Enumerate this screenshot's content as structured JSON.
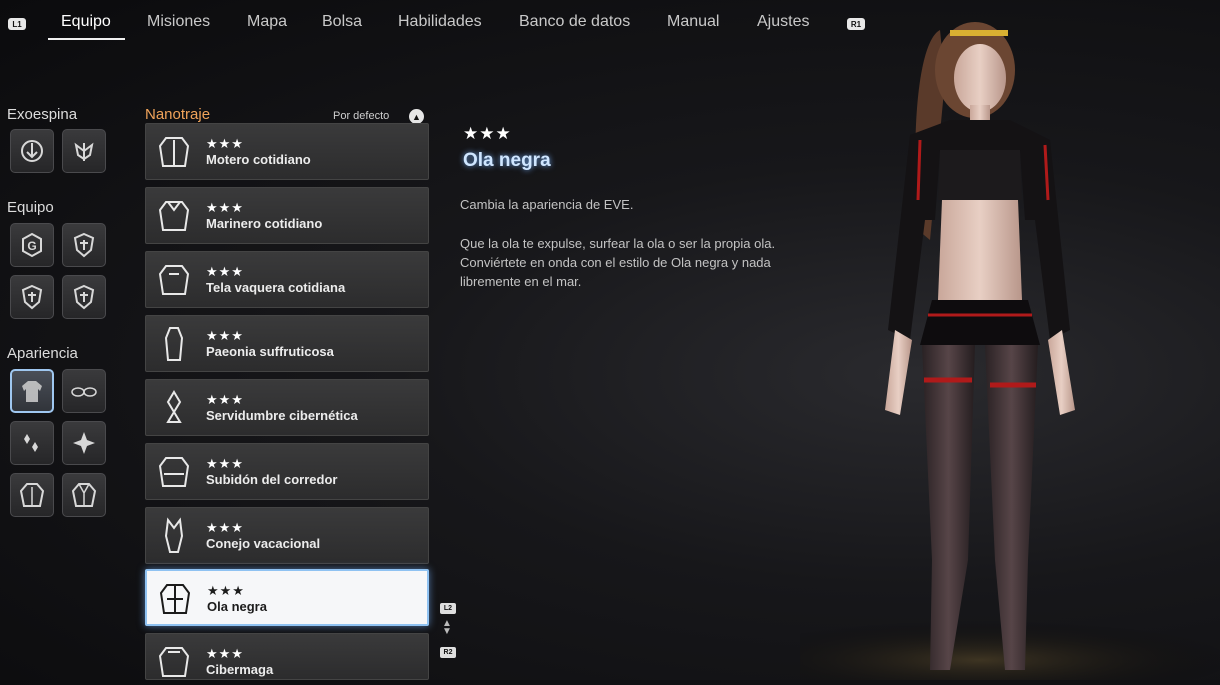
{
  "nav": {
    "left_hint": "L1",
    "right_hint": "R1",
    "tabs": [
      {
        "label": "Equipo"
      },
      {
        "label": "Misiones"
      },
      {
        "label": "Mapa"
      },
      {
        "label": "Bolsa"
      },
      {
        "label": "Habilidades"
      },
      {
        "label": "Banco de datos"
      },
      {
        "label": "Manual"
      },
      {
        "label": "Ajustes"
      }
    ],
    "active_tab": "Equipo"
  },
  "sidebar": {
    "exoespina": {
      "title": "Exoespina",
      "slots": [
        "exospine-core-icon",
        "exospine-wings-icon"
      ]
    },
    "equipo": {
      "title": "Equipo",
      "slots": [
        "gear-g-icon",
        "shield-gear-icon",
        "shield-gear-icon",
        "shield-gear-icon"
      ]
    },
    "apariencia": {
      "title": "Apariencia",
      "slots": [
        "outfit-icon",
        "glasses-icon",
        "earrings-icon",
        "hair-ornament-icon",
        "jacket-icon",
        "jacket-alt-icon"
      ],
      "selected_index": 0
    }
  },
  "list": {
    "title": "Nanotraje",
    "sort_label": "Por defecto",
    "sort_button": "triangle-button-icon",
    "items": [
      {
        "stars": "★★★",
        "name": "Motero cotidiano"
      },
      {
        "stars": "★★★",
        "name": "Marinero cotidiano"
      },
      {
        "stars": "★★★",
        "name": "Tela vaquera cotidiana"
      },
      {
        "stars": "★★★",
        "name": "Paeonia suffruticosa"
      },
      {
        "stars": "★★★",
        "name": "Servidumbre cibernética"
      },
      {
        "stars": "★★★",
        "name": "Subidón del corredor"
      },
      {
        "stars": "★★★",
        "name": "Conejo vacacional"
      },
      {
        "stars": "★★★",
        "name": "Ola negra"
      },
      {
        "stars": "★★★",
        "name": "Cibermaga"
      }
    ],
    "selected_index": 7,
    "scroll_up_hint": "L2",
    "scroll_down_hint": "R2"
  },
  "detail": {
    "stars": "★★★",
    "title": "Ola negra",
    "description": "Cambia la apariencia de EVE.",
    "flavor": "Que la ola te expulse, surfear la ola o ser la propia ola. Conviértete en onda con el estilo de Ola negra y nada libremente en el mar."
  },
  "colors": {
    "accent_orange": "#f0a35a",
    "selected_border": "#8fc2f2",
    "title_glow": "#cfe6ff"
  }
}
